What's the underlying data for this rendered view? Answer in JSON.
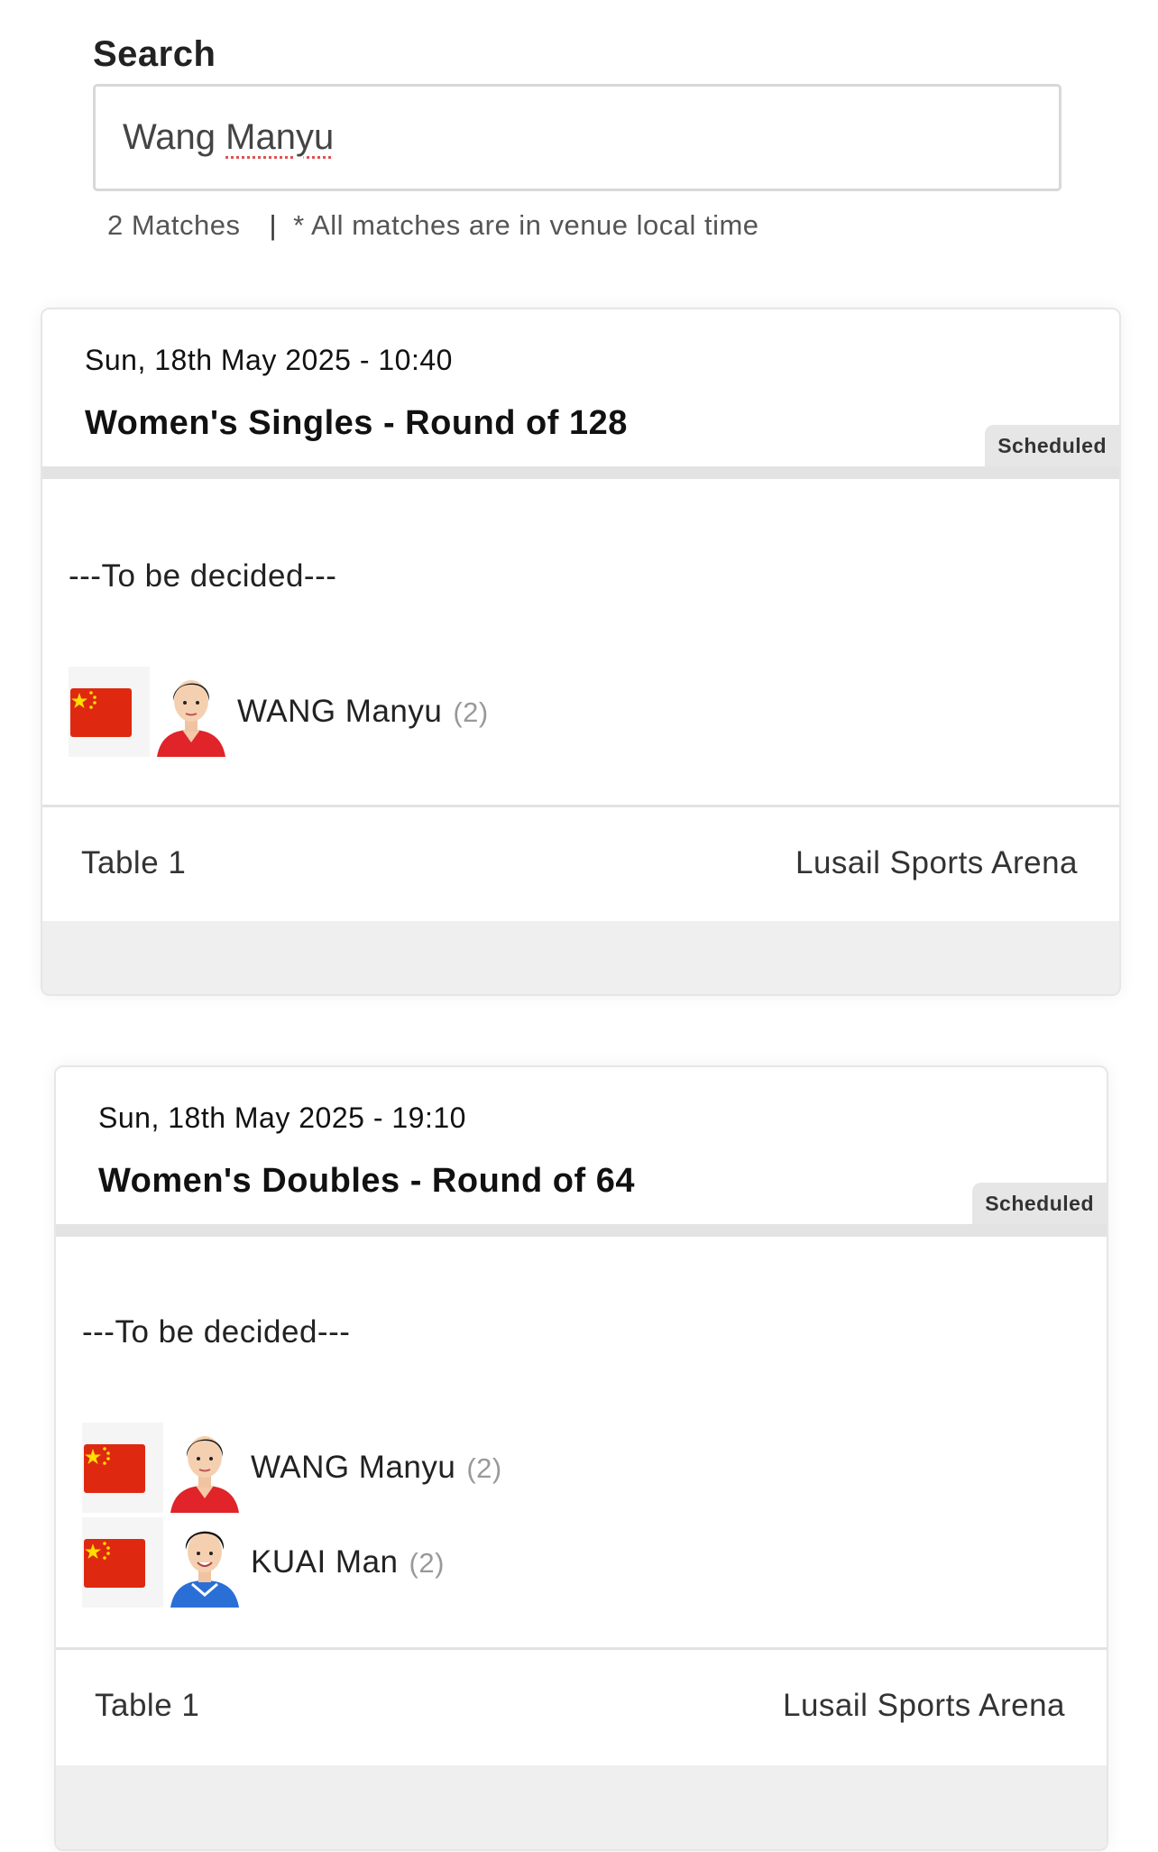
{
  "search": {
    "label": "Search",
    "value_first": "Wang",
    "value_second": "Manyu",
    "match_count": "2 Matches",
    "separator": "|",
    "note": "* All matches are in venue local time"
  },
  "matches": [
    {
      "datetime": "Sun, 18th May 2025 - 10:40",
      "title": "Women's Singles - Round of 128",
      "status": "Scheduled",
      "opponent": "---To be decided---",
      "players": [
        {
          "country_flag": "china-flag",
          "name": "WANG Manyu",
          "seed": "(2)"
        }
      ],
      "table": "Table 1",
      "venue": "Lusail Sports Arena"
    },
    {
      "datetime": "Sun, 18th May 2025 - 19:10",
      "title": "Women's Doubles - Round of 64",
      "status": "Scheduled",
      "opponent": "---To be decided---",
      "players": [
        {
          "country_flag": "china-flag",
          "name": "WANG Manyu",
          "seed": "(2)"
        },
        {
          "country_flag": "china-flag",
          "name": "KUAI Man",
          "seed": "(2)"
        }
      ],
      "table": "Table 1",
      "venue": "Lusail Sports Arena"
    }
  ],
  "colors": {
    "flag_red": "#de2910",
    "flag_star": "#ffde00",
    "jersey_red": "#e0242a",
    "jersey_blue": "#2a6fd6"
  }
}
